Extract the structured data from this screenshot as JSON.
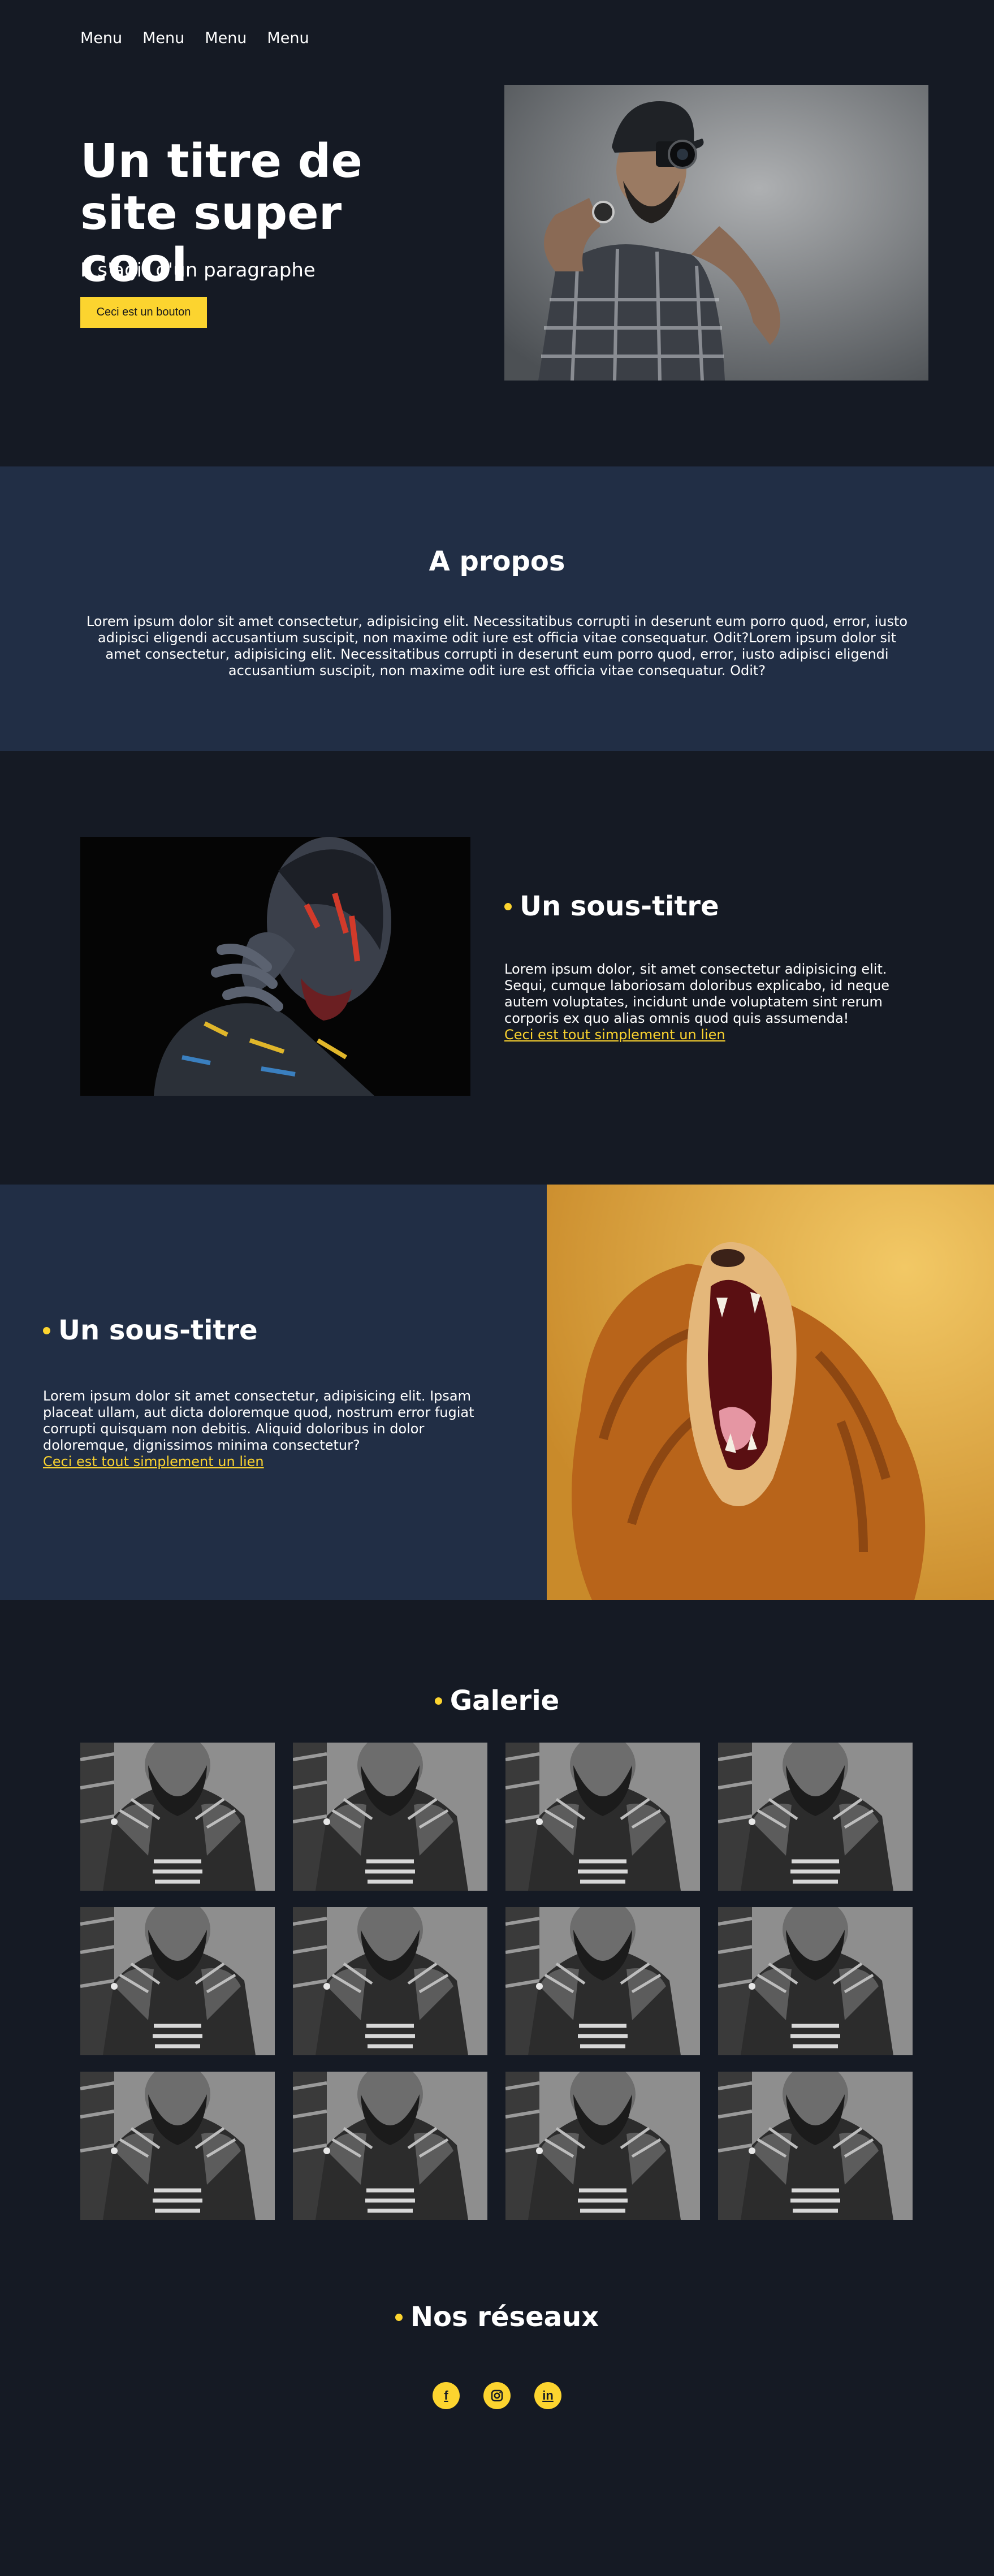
{
  "nav": {
    "items": [
      "Menu",
      "Menu",
      "Menu",
      "Menu"
    ]
  },
  "hero": {
    "title": "Un titre de site super cool",
    "paragraph": "Il s'agit d'un paragraphe",
    "button_label": "Ceci est un bouton",
    "image_icon": "photographer-photo"
  },
  "about": {
    "title": "A propos",
    "text": "Lorem ipsum dolor sit amet consectetur, adipisicing elit. Necessitatibus corrupti in deserunt eum porro quod, error, iusto adipisci eligendi accusantium suscipit, non maxime odit iure est officia vitae consequatur. Odit?Lorem ipsum dolor sit amet consectetur, adipisicing elit. Necessitatibus corrupti in deserunt eum porro quod, error, iusto adipisci eligendi accusantium suscipit, non maxime odit iure est officia vitae consequatur. Odit?"
  },
  "section1": {
    "title": "Un sous-titre",
    "text": "Lorem ipsum dolor, sit amet consectetur adipisicing elit. Sequi, cumque laboriosam doloribus explicabo, id neque autem voluptates, incidunt unde voluptatem sint rerum corporis ex quo alias omnis quod quis assumenda!",
    "link": "Ceci est tout simplement un lien",
    "image_icon": "painted-face-photo"
  },
  "section2": {
    "title": "Un sous-titre",
    "text": "Lorem ipsum dolor sit amet consectetur, adipisicing elit. Ipsam placeat ullam, aut dicta doloremque quod, nostrum error fugiat corrupti quisquam non debitis. Aliquid doloribus in dolor doloremque, dignissimos minima consectetur?",
    "link": "Ceci est tout simplement un lien",
    "image_icon": "roaring-lion-photo"
  },
  "gallery": {
    "title": "Galerie",
    "item_count": 12,
    "image_icon": "bearded-man-photo"
  },
  "social": {
    "title": "Nos réseaux",
    "icons": [
      {
        "name": "facebook-icon",
        "glyph": "f"
      },
      {
        "name": "instagram-icon",
        "glyph": "◘"
      },
      {
        "name": "linkedin-icon",
        "glyph": "in"
      }
    ]
  },
  "colors": {
    "background": "#151a24",
    "panel": "#212e45",
    "accent": "#fcd42f"
  }
}
